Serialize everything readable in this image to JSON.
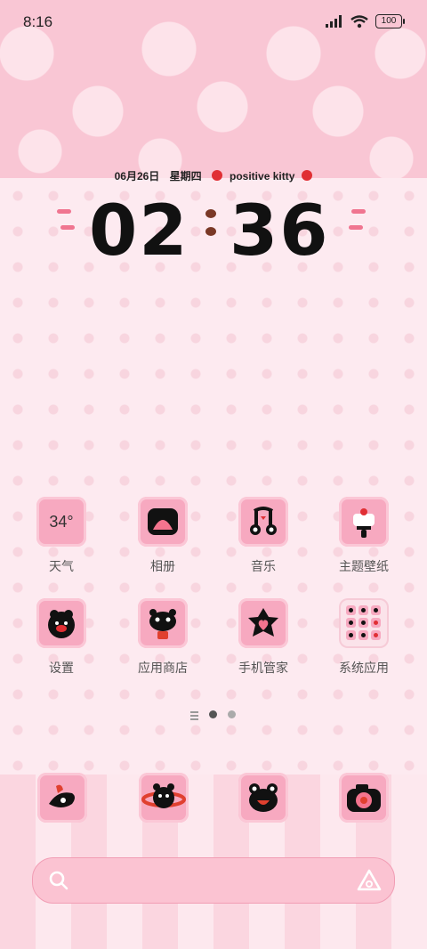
{
  "status": {
    "time": "8:16",
    "battery": "100"
  },
  "widget": {
    "date": "06月26日",
    "weekday": "星期四",
    "brand": "positive kitty",
    "hour": "02",
    "minute": "36"
  },
  "apps": [
    {
      "label": "天气",
      "value": "34°"
    },
    {
      "label": "相册"
    },
    {
      "label": "音乐"
    },
    {
      "label": "主题壁纸"
    },
    {
      "label": "设置"
    },
    {
      "label": "应用商店"
    },
    {
      "label": "手机管家"
    },
    {
      "label": "系统应用"
    }
  ],
  "colors": {
    "accent": "#f7a9c0",
    "cat": "#111111",
    "red": "#e02f34"
  }
}
